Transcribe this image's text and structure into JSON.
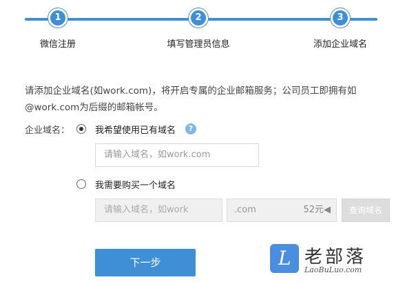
{
  "steps": [
    {
      "number": "1",
      "label": "微信注册"
    },
    {
      "number": "2",
      "label": "填写管理员信息"
    },
    {
      "number": "3",
      "label": "添加企业域名"
    }
  ],
  "description": {
    "line1": "请添加企业域名(如work.com)，将开启专属的企业邮箱服务；公司员工即拥有如",
    "line2": "@work.com为后缀的邮箱帐号。"
  },
  "form": {
    "domain_label": "企业域名：",
    "option_existing": {
      "label": "我希望使用已有域名",
      "checked": true,
      "help_icon": "question-icon",
      "help_text": "?",
      "input_placeholder": "请输入域名，如work.com"
    },
    "option_buy": {
      "label": "我需要购买一个域名",
      "checked": false,
      "input_placeholder": "请输入域名，如work",
      "suffix": ".com",
      "price": "52元◀",
      "query_button": "查询域名"
    },
    "next_button": "下一步"
  },
  "watermark": {
    "logo_letter": "L",
    "title": "老部落",
    "url": "LaoBuLuo.com"
  },
  "colors": {
    "accent": "#3f8fd6",
    "help_icon": "#7fb7e6",
    "disabled_bg": "#f0f0f0"
  }
}
